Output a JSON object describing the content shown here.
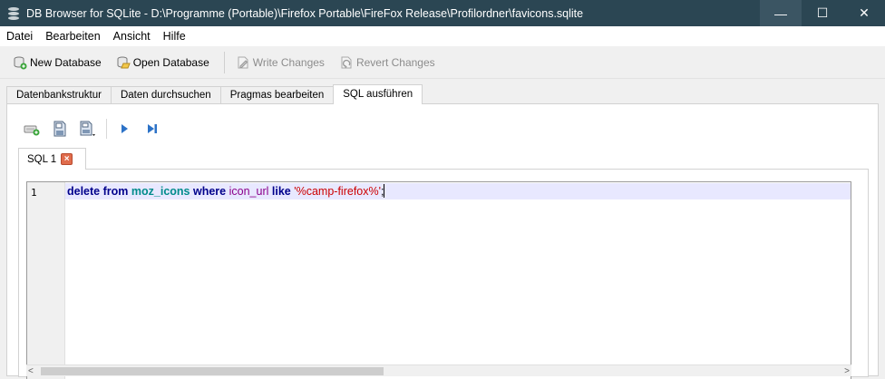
{
  "window": {
    "title": "DB Browser for SQLite - D:\\Programme (Portable)\\Firefox Portable\\FireFox Release\\Profilordner\\favicons.sqlite",
    "min_glyph": "—",
    "max_glyph": "☐",
    "close_glyph": "✕"
  },
  "menu": {
    "items": [
      {
        "label": "Datei"
      },
      {
        "label": "Bearbeiten"
      },
      {
        "label": "Ansicht"
      },
      {
        "label": "Hilfe"
      }
    ]
  },
  "toolbar": {
    "new_db": "New Database",
    "open_db": "Open Database",
    "write": "Write Changes",
    "revert": "Revert Changes"
  },
  "tabs": [
    {
      "label": "Datenbankstruktur"
    },
    {
      "label": "Daten durchsuchen"
    },
    {
      "label": "Pragmas bearbeiten"
    },
    {
      "label": "SQL ausführen"
    }
  ],
  "editor": {
    "tab_label": "SQL 1",
    "line_number": "1",
    "code": {
      "kw1": "delete",
      "kw2": "from",
      "table": "moz_icons",
      "kw3": "where",
      "column": "icon_url",
      "kw4": "like",
      "string": "'%camp-firefox%'",
      "end": ";"
    }
  },
  "colors": {
    "titlebar": "#2b4653",
    "keyword": "#00008b",
    "table": "#008b8b",
    "column": "#8b008b",
    "string": "#cc0000",
    "current_line": "#e8e8ff"
  }
}
